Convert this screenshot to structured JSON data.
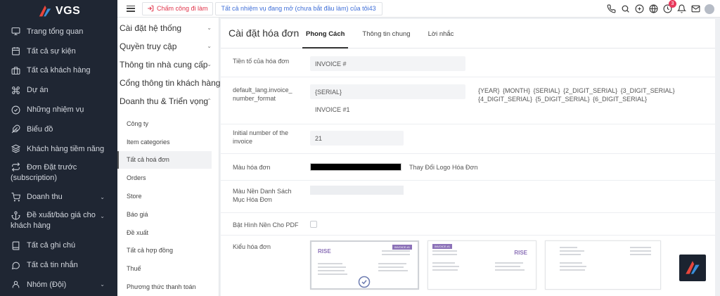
{
  "brand": {
    "name": "VGS"
  },
  "sidebar": {
    "items": [
      {
        "label": "Trang tổng quan",
        "icon": "monitor-icon"
      },
      {
        "label": "Tất cả sự kiện",
        "icon": "calendar-icon"
      },
      {
        "label": "Tất cả khách hàng",
        "icon": "briefcase-icon"
      },
      {
        "label": "Dự án",
        "icon": "command-icon"
      },
      {
        "label": "Những nhiệm vụ",
        "icon": "check-circle-icon"
      },
      {
        "label": "Biểu đồ",
        "icon": "feather-icon"
      },
      {
        "label": "Khách hàng tiềm năng",
        "icon": "layers-icon"
      },
      {
        "label": "Đơn Đặt trước (subscription)",
        "icon": "repeat-icon"
      },
      {
        "label": "Doanh thu",
        "icon": "cart-icon",
        "expandable": true
      },
      {
        "label": "Đề xuất/báo giá cho khách hàng",
        "icon": "anchor-icon",
        "expandable": true
      },
      {
        "label": "Tất cả ghi chú",
        "icon": "book-icon"
      },
      {
        "label": "Tất cả tin nhắn",
        "icon": "message-icon"
      },
      {
        "label": "Nhóm (Đội)",
        "icon": "user-icon",
        "expandable": true
      }
    ]
  },
  "topbar": {
    "clock_in_label": "Chấm công đi làm",
    "task_link": "Tất cả nhiệm vụ đang mở (chưa bắt đầu làm) của tôi43",
    "reminder_badge": "3",
    "icons": [
      "phone-icon",
      "search-icon",
      "plus-circle-icon",
      "globe-icon",
      "clock-icon",
      "bell-icon",
      "mail-icon"
    ]
  },
  "settings_menu": {
    "groups": [
      {
        "label": "Cài đặt hệ thống",
        "caret": "chevron-down-icon"
      },
      {
        "label": "Quyền truy cập",
        "caret": "chevron-down-icon"
      },
      {
        "label": "Thông tin nhà cung cấp",
        "caret": "chevron-down-icon"
      },
      {
        "label": "Cổng thông tin khách hàng",
        "caret": ""
      },
      {
        "label": "Doanh thu & Triển vọng",
        "caret": "chevron-up-icon"
      }
    ],
    "sub_items": [
      {
        "label": "Công ty",
        "active": false
      },
      {
        "label": "Item categories",
        "active": false
      },
      {
        "label": "Tất cả hoá đơn",
        "active": true
      },
      {
        "label": "Orders",
        "active": false
      },
      {
        "label": "Store",
        "active": false
      },
      {
        "label": "Báo giá",
        "active": false
      },
      {
        "label": "Đề xuất",
        "active": false
      },
      {
        "label": "Tất cả hợp đồng",
        "active": false
      },
      {
        "label": "Thuế",
        "active": false
      },
      {
        "label": "Phương thức thanh toán",
        "active": false
      }
    ]
  },
  "main": {
    "title": "Cài đặt hóa đơn",
    "tabs": [
      {
        "label": "Phong Cách",
        "active": true
      },
      {
        "label": "Thông tin chung",
        "active": false
      },
      {
        "label": "Lời nhắc",
        "active": false
      }
    ],
    "fields": {
      "prefix_label": "Tiền tố của hóa đơn",
      "prefix_value": "INVOICE #",
      "format_label": "default_lang.invoice_number_format",
      "format_value": "{SERIAL}",
      "format_preview": "INVOICE #1",
      "format_tokens": "{YEAR}   {MONTH}   {SERIAL}   {2_DIGIT_SERIAL}   {3_DIGIT_SERIAL}   {4_DIGIT_SERIAL}   {5_DIGIT_SERIAL}   {6_DIGIT_SERIAL}",
      "initial_label": "Initial number of the invoice",
      "initial_value": "21",
      "color_label": "Màu hóa đơn",
      "color_value": "#000000",
      "change_logo_label": "Thay Đổi Logo Hóa Đơn",
      "bg_color_label": "Màu Nền Danh Sách Mục Hóa Đơn",
      "pdf_bg_label": "Bật Hình Nền Cho PDF",
      "style_label": "Kiểu hóa đơn",
      "styles": [
        {
          "brand": "RISE",
          "badge": "INVOICE #1",
          "selected": true
        },
        {
          "brand": "RISE",
          "badge": "INVOICE #1",
          "selected": false
        },
        {
          "brand": "",
          "badge": "",
          "selected": false
        }
      ]
    }
  },
  "colors": {
    "sidebar_bg": "#1f2633",
    "accent_red": "#e0344b",
    "link_blue": "#3f6fd8",
    "badge_pink": "#e8395c",
    "invoice_purple": "#8c72b8"
  }
}
